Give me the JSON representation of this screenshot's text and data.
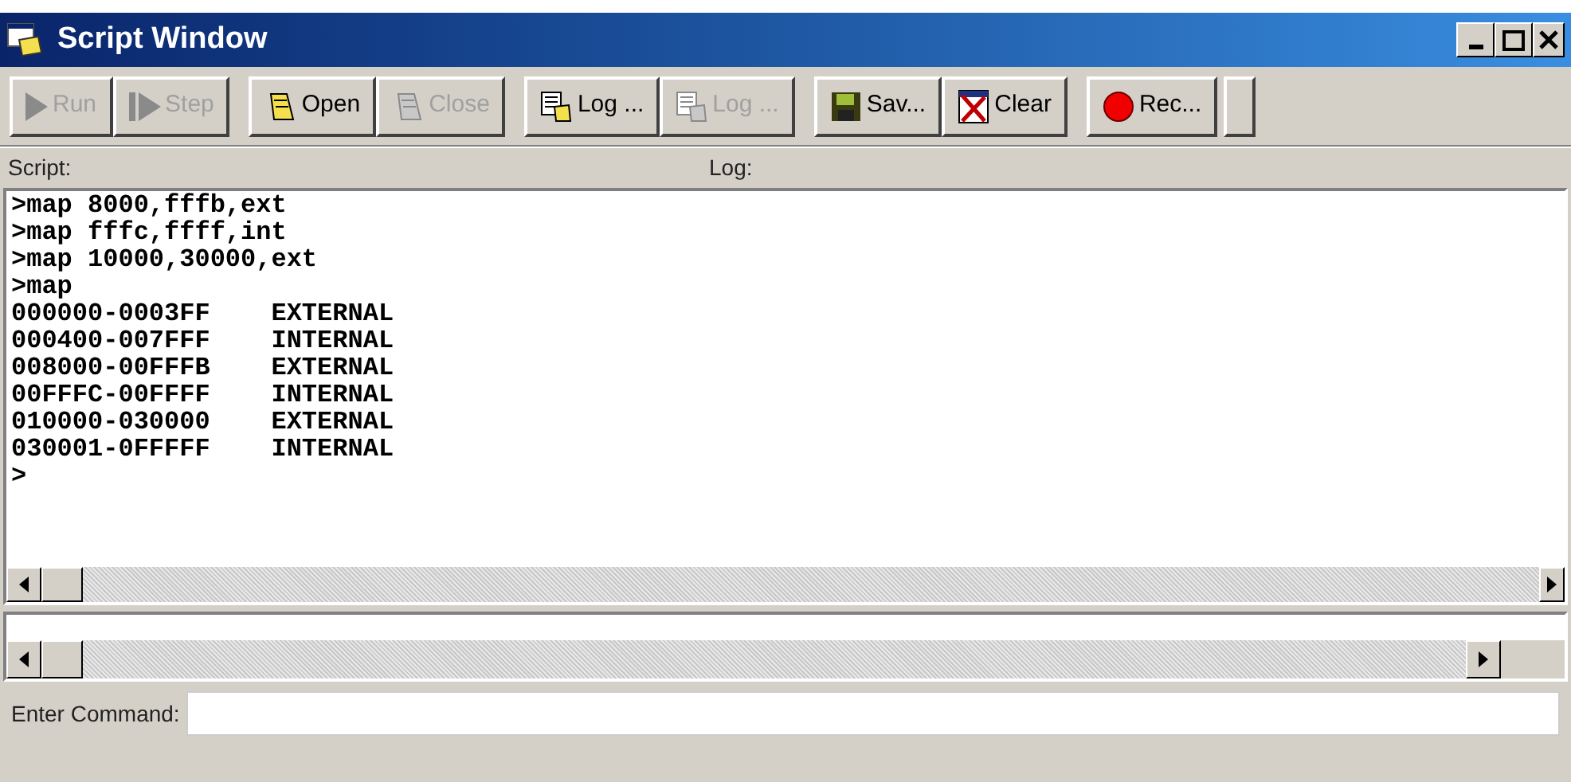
{
  "window": {
    "title": "Script Window"
  },
  "toolbar_groups": [
    [
      {
        "label": "Run",
        "disabled": true
      },
      {
        "label": "Step",
        "disabled": true
      }
    ],
    [
      {
        "label": "Open",
        "disabled": false
      },
      {
        "label": "Close",
        "disabled": true
      }
    ],
    [
      {
        "label": "Log ...",
        "disabled": false
      },
      {
        "label": "Log ...",
        "disabled": true
      }
    ],
    [
      {
        "label": "Sav...",
        "disabled": false
      },
      {
        "label": "Clear",
        "disabled": false
      }
    ],
    [
      {
        "label": "Rec...",
        "disabled": false
      }
    ]
  ],
  "script_label": "Script:",
  "log_label": "Log:",
  "script_lines": [
    ">map 8000,fffb,ext",
    ">map fffc,ffff,int",
    ">map 10000,30000,ext",
    ">map",
    "000000-0003FF    EXTERNAL",
    "000400-007FFF    INTERNAL",
    "008000-00FFFB    EXTERNAL",
    "00FFFC-00FFFF    INTERNAL",
    "010000-030000    EXTERNAL",
    "030001-0FFFFF    INTERNAL",
    ">"
  ],
  "command": {
    "label": "Enter Command:"
  }
}
